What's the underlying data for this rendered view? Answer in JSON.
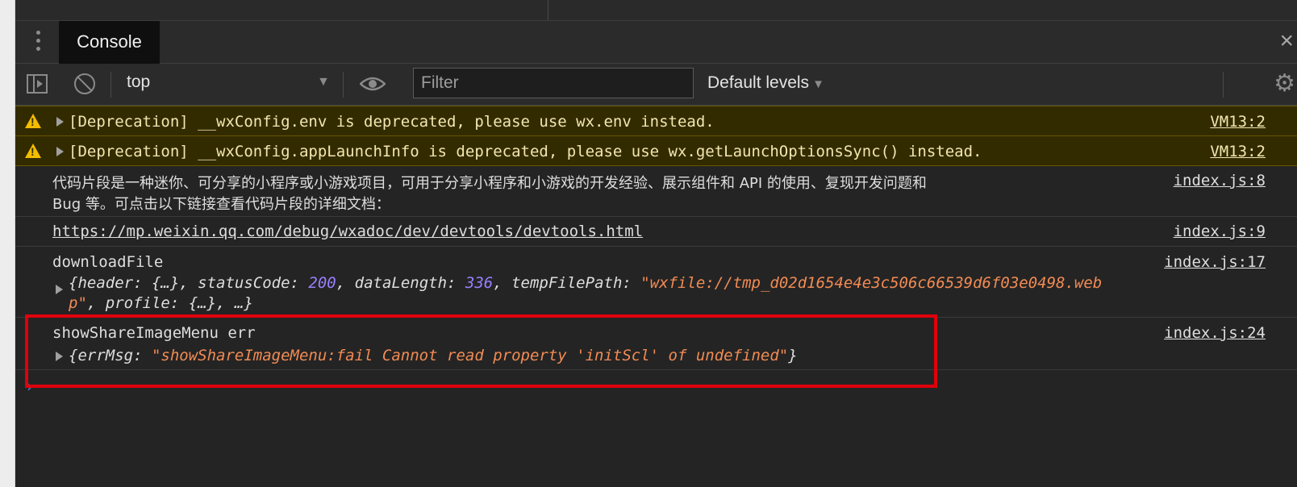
{
  "drawer": {
    "tab_label": "Console",
    "close_label": "×"
  },
  "toolbar": {
    "context": "top",
    "filter_placeholder": "Filter",
    "levels_label": "Default levels"
  },
  "messages": [
    {
      "text": "[Deprecation] __wxConfig.env is deprecated, please use wx.env instead.",
      "source": "VM13:2"
    },
    {
      "text": "[Deprecation] __wxConfig.appLaunchInfo is deprecated, please use wx.getLaunchOptionsSync() instead.",
      "source": "VM13:2"
    },
    {
      "line1": "代码片段是一种迷你、可分享的小程序或小游戏项目，可用于分享小程序和小游戏的开发经验、展示组件和 API 的使用、复现开发问题和",
      "line2": "Bug 等。可点击以下链接查看代码片段的详细文档：",
      "source": "index.js:8"
    },
    {
      "text": "https://mp.weixin.qq.com/debug/wxadoc/dev/devtools/devtools.html",
      "source": "index.js:9"
    },
    {
      "label": "downloadFile",
      "source": "index.js:17",
      "obj_l1_p1": "{header: {…}, statusCode: ",
      "obj_status": "200",
      "obj_l1_p2": ", dataLength: ",
      "obj_len": "336",
      "obj_l1_p3": ", tempFilePath: ",
      "obj_path1": "\"wxfile://tmp_d02d1654e4e3c506c66539d6f03e0498.web",
      "obj_path2": "p\"",
      "obj_l2_rest": ", profile: {…}, …}"
    },
    {
      "label": "showShareImageMenu err",
      "source": "index.js:24",
      "obj_open": "{errMsg: ",
      "obj_err": "\"showShareImageMenu:fail Cannot read property 'initScl' of undefined\"",
      "obj_close": "}"
    }
  ],
  "prompt_symbol": "›",
  "colors": {
    "warning_bg": "#332b00",
    "string": "#f28b54",
    "number": "#9980ff",
    "highlight_border": "#e0000b"
  }
}
